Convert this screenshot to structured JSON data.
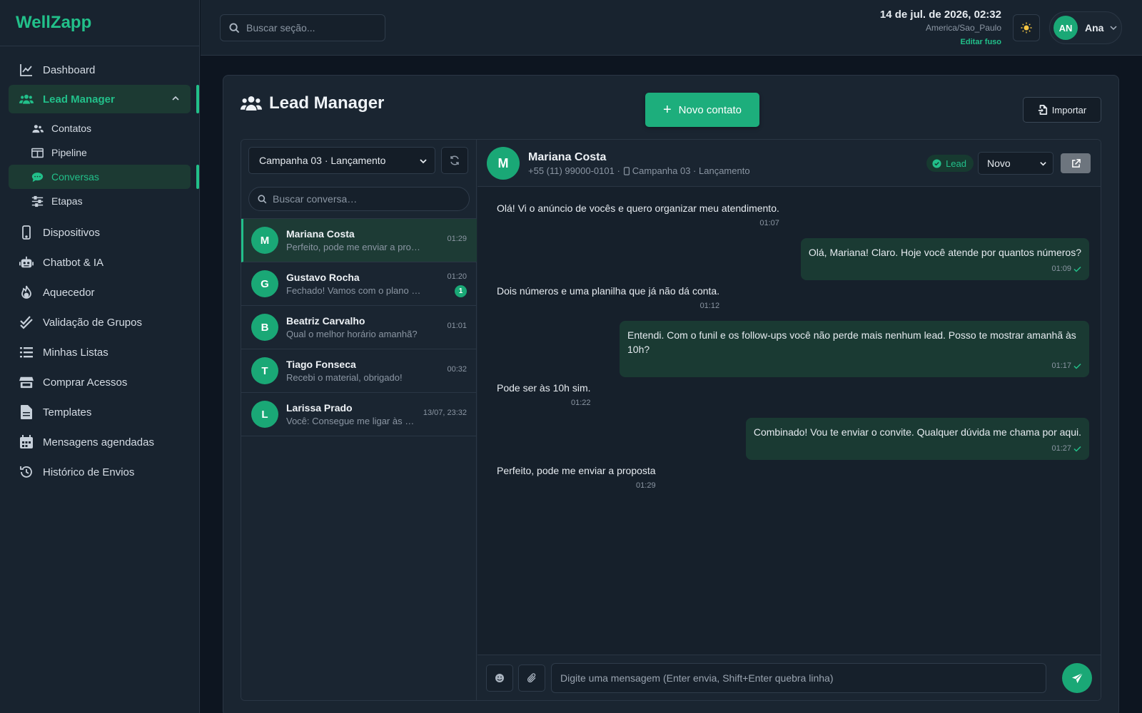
{
  "app": {
    "logo": "WellZapp"
  },
  "sidebar": {
    "items": [
      {
        "label": "Dashboard",
        "icon": "chart-line-icon"
      },
      {
        "label": "Lead Manager",
        "icon": "users-icon",
        "active": true
      },
      {
        "label": "Dispositivos",
        "icon": "mobile-icon"
      },
      {
        "label": "Chatbot & IA",
        "icon": "robot-icon"
      },
      {
        "label": "Aquecedor",
        "icon": "fire-icon"
      },
      {
        "label": "Validação de Grupos",
        "icon": "check-double-icon"
      },
      {
        "label": "Minhas Listas",
        "icon": "list-icon"
      },
      {
        "label": "Comprar Acessos",
        "icon": "store-icon"
      },
      {
        "label": "Templates",
        "icon": "file-icon"
      },
      {
        "label": "Mensagens agendadas",
        "icon": "calendar-icon"
      },
      {
        "label": "Histórico de Envios",
        "icon": "history-icon"
      }
    ],
    "sub_items": [
      {
        "label": "Contatos",
        "icon": "users-icon"
      },
      {
        "label": "Pipeline",
        "icon": "columns-icon"
      },
      {
        "label": "Conversas",
        "icon": "comments-icon",
        "active": true
      },
      {
        "label": "Etapas",
        "icon": "sliders-icon"
      }
    ]
  },
  "topbar": {
    "search_placeholder": "Buscar seção...",
    "datetime": "14 de jul. de 2026, 02:32",
    "timezone": "America/Sao_Paulo",
    "edit_timezone": "Editar fuso",
    "user_initials": "AN",
    "user_name": "Ana"
  },
  "page": {
    "title": "Lead Manager",
    "new_contact": "Novo contato",
    "import": "Importar"
  },
  "conversations": {
    "campaign": "Campanha 03 · Lançamento",
    "search_placeholder": "Buscar conversa…",
    "list": [
      {
        "initial": "M",
        "name": "Mariana Costa",
        "preview": "Perfeito, pode me enviar a proposta",
        "time": "01:29",
        "active": true
      },
      {
        "initial": "G",
        "name": "Gustavo Rocha",
        "preview": "Fechado! Vamos com o plano Escala.",
        "time": "01:20",
        "unread": "1"
      },
      {
        "initial": "B",
        "name": "Beatriz Carvalho",
        "preview": "Qual o melhor horário amanhã?",
        "time": "01:01"
      },
      {
        "initial": "T",
        "name": "Tiago Fonseca",
        "preview": "Recebi o material, obrigado!",
        "time": "00:32"
      },
      {
        "initial": "L",
        "name": "Larissa Prado",
        "preview": "Você: Consegue me ligar às 1...",
        "time": "13/07, 23:32"
      }
    ]
  },
  "chat": {
    "initial": "M",
    "name": "Mariana Costa",
    "phone": "+55 (11) 99000-0101 ·",
    "campaign": "Campanha 03 · Lançamento",
    "tag": "Lead",
    "status": "Novo",
    "input_placeholder": "Digite uma mensagem (Enter envia, Shift+Enter quebra linha)",
    "messages": [
      {
        "dir": "in",
        "text": "Olá! Vi o anúncio de vocês e quero organizar meu atendimento.",
        "time": "01:07"
      },
      {
        "dir": "out",
        "text": "Olá, Mariana! Claro. Hoje você atende por quantos números?",
        "time": "01:09"
      },
      {
        "dir": "in",
        "text": "Dois números e uma planilha que já não dá conta.",
        "time": "01:12"
      },
      {
        "dir": "out",
        "text": "Entendi. Com o funil e os follow-ups você não perde mais nenhum lead. Posso te mostrar amanhã às 10h?",
        "time": "01:17"
      },
      {
        "dir": "in",
        "text": "Pode ser às 10h sim.",
        "time": "01:22"
      },
      {
        "dir": "out",
        "text": "Combinado! Vou te enviar o convite. Qualquer dúvida me chama por aqui.",
        "time": "01:27"
      },
      {
        "dir": "in",
        "text": "Perfeito, pode me enviar a proposta",
        "time": "01:29"
      }
    ]
  },
  "colors": {
    "accent": "#22c08a",
    "background": "#0d1520",
    "panel": "#1a2531",
    "outgoing_bubble": "#1a3a33"
  }
}
